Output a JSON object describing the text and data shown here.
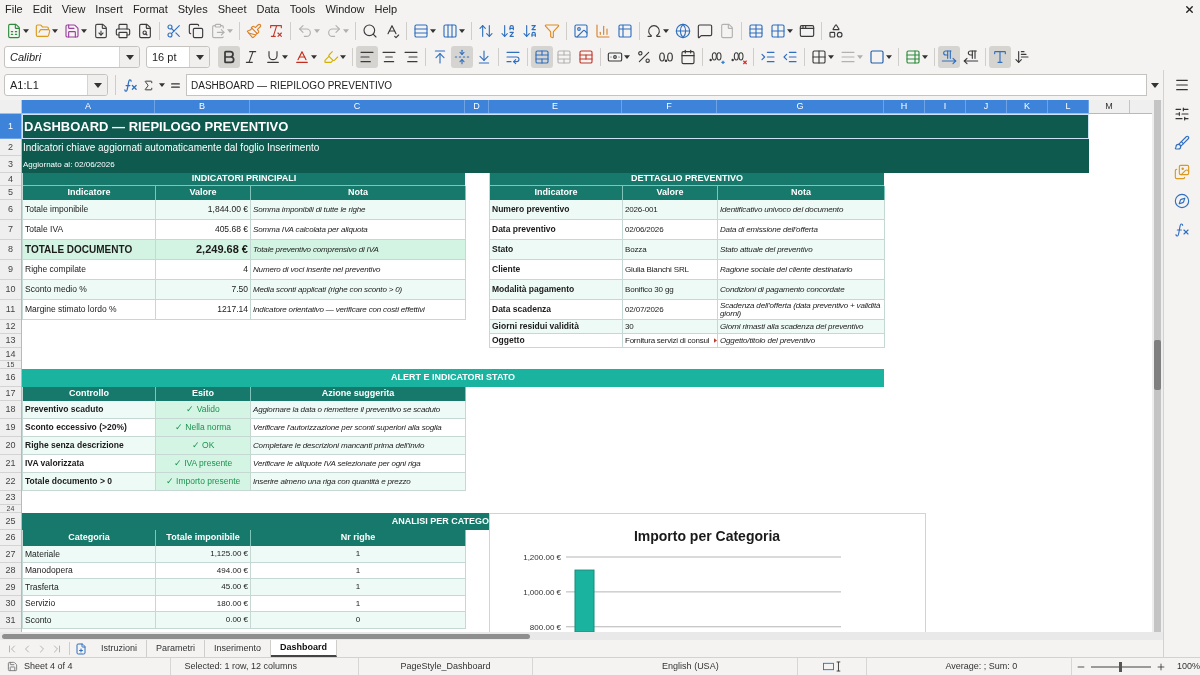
{
  "menu_bar": {
    "items": [
      "File",
      "Edit",
      "View",
      "Insert",
      "Format",
      "Styles",
      "Sheet",
      "Data",
      "Tools",
      "Window",
      "Help"
    ]
  },
  "standard_toolbar": {
    "buttons": [
      {
        "kind": "new",
        "disabled": false
      },
      {
        "kind": "open",
        "disabled": false
      },
      {
        "kind": "save",
        "disabled": false
      },
      {
        "kind": "export_pdf",
        "disabled": false
      },
      {
        "kind": "print",
        "disabled": false
      },
      {
        "kind": "print_preview",
        "disabled": false
      },
      {
        "kind": "cut",
        "disabled": false
      },
      {
        "kind": "copy",
        "disabled": false
      },
      {
        "kind": "paste",
        "disabled": true
      },
      {
        "kind": "clone_formatting",
        "disabled": false
      },
      {
        "kind": "clear_formatting",
        "disabled": false
      },
      {
        "kind": "undo",
        "disabled": true
      },
      {
        "kind": "redo",
        "disabled": true
      },
      {
        "kind": "find_replace",
        "disabled": false
      },
      {
        "kind": "spelling",
        "disabled": false
      },
      {
        "kind": "row",
        "disabled": false
      },
      {
        "kind": "column",
        "disabled": false
      },
      {
        "kind": "sort",
        "disabled": false
      },
      {
        "kind": "sort_ascending",
        "disabled": false
      },
      {
        "kind": "sort_descending",
        "disabled": false
      },
      {
        "kind": "autofilter",
        "disabled": false
      },
      {
        "kind": "image",
        "disabled": false
      },
      {
        "kind": "chart",
        "disabled": false
      },
      {
        "kind": "pivot_table",
        "disabled": false
      },
      {
        "kind": "special_character",
        "disabled": false
      },
      {
        "kind": "hyperlink",
        "disabled": false
      },
      {
        "kind": "comment",
        "disabled": false
      },
      {
        "kind": "header_footer",
        "disabled": true
      },
      {
        "kind": "print_area",
        "disabled": false
      },
      {
        "kind": "freeze",
        "disabled": false
      },
      {
        "kind": "split_window",
        "disabled": false
      },
      {
        "kind": "draw_functions",
        "disabled": false
      }
    ]
  },
  "formatting_toolbar": {
    "font_name": "Calibri",
    "font_size": "16 pt",
    "buttons": [
      {
        "kind": "bold",
        "active": true,
        "disabled": false
      },
      {
        "kind": "italic",
        "active": false,
        "disabled": false
      },
      {
        "kind": "underline",
        "active": false,
        "disabled": false
      },
      {
        "kind": "font_color",
        "active": false,
        "disabled": false
      },
      {
        "kind": "highlight",
        "active": false,
        "disabled": false
      },
      {
        "kind": "align_left",
        "active": true,
        "disabled": false
      },
      {
        "kind": "align_center",
        "active": false,
        "disabled": false
      },
      {
        "kind": "align_right",
        "active": false,
        "disabled": false
      },
      {
        "kind": "align_top",
        "active": false,
        "disabled": false
      },
      {
        "kind": "align_middle",
        "active": true,
        "disabled": false
      },
      {
        "kind": "align_bottom",
        "active": false,
        "disabled": false
      },
      {
        "kind": "wrap",
        "active": false,
        "disabled": false
      },
      {
        "kind": "merge_center",
        "active": true,
        "disabled": false
      },
      {
        "kind": "merge",
        "active": false,
        "disabled": true
      },
      {
        "kind": "unmerge",
        "active": false,
        "disabled": false
      },
      {
        "kind": "currency",
        "active": false,
        "disabled": false
      },
      {
        "kind": "percent",
        "active": false,
        "disabled": false
      },
      {
        "kind": "number",
        "active": false,
        "disabled": false
      },
      {
        "kind": "date",
        "active": false,
        "disabled": false
      },
      {
        "kind": "add_decimal",
        "active": false,
        "disabled": false
      },
      {
        "kind": "delete_decimal",
        "active": false,
        "disabled": false
      },
      {
        "kind": "indent_increase",
        "active": false,
        "disabled": false
      },
      {
        "kind": "indent_decrease",
        "active": false,
        "disabled": false
      },
      {
        "kind": "borders",
        "active": false,
        "disabled": false
      },
      {
        "kind": "border_style",
        "active": false,
        "disabled": true
      },
      {
        "kind": "border_color",
        "active": false,
        "disabled": false
      },
      {
        "kind": "conditional",
        "active": false,
        "disabled": false
      },
      {
        "kind": "ltr",
        "active": true,
        "disabled": false
      },
      {
        "kind": "rtl",
        "active": false,
        "disabled": false
      },
      {
        "kind": "horizontal_text",
        "active": true,
        "disabled": false
      },
      {
        "kind": "vertical_text",
        "active": false,
        "disabled": false
      }
    ]
  },
  "formula_bar": {
    "name_box": "A1:L1",
    "content": "DASHBOARD — RIEPILOGO PREVENTIVO"
  },
  "sheet": {
    "columns": [
      {
        "label": "A",
        "selected": true
      },
      {
        "label": "B",
        "selected": true
      },
      {
        "label": "C",
        "selected": true
      },
      {
        "label": "D",
        "selected": true
      },
      {
        "label": "E",
        "selected": true
      },
      {
        "label": "F",
        "selected": true
      },
      {
        "label": "G",
        "selected": true
      },
      {
        "label": "H",
        "selected": true
      },
      {
        "label": "I",
        "selected": true
      },
      {
        "label": "J",
        "selected": true
      },
      {
        "label": "K",
        "selected": true
      },
      {
        "label": "L",
        "selected": true
      },
      {
        "label": "M",
        "selected": false
      }
    ],
    "rows": [
      {
        "label": "1",
        "selected": true
      },
      {
        "label": "2",
        "selected": false
      },
      {
        "label": "3",
        "selected": false
      },
      {
        "label": "4",
        "selected": false
      },
      {
        "label": "5",
        "selected": false
      },
      {
        "label": "6",
        "selected": false
      },
      {
        "label": "7",
        "selected": false
      },
      {
        "label": "8",
        "selected": false
      },
      {
        "label": "9",
        "selected": false
      },
      {
        "label": "10",
        "selected": false
      },
      {
        "label": "11",
        "selected": false
      },
      {
        "label": "12",
        "selected": false
      },
      {
        "label": "13",
        "selected": false
      },
      {
        "label": "14",
        "selected": false
      },
      {
        "label": "15",
        "selected": false
      },
      {
        "label": "16",
        "selected": false
      },
      {
        "label": "17",
        "selected": false
      },
      {
        "label": "18",
        "selected": false
      },
      {
        "label": "19",
        "selected": false
      },
      {
        "label": "20",
        "selected": false
      },
      {
        "label": "21",
        "selected": false
      },
      {
        "label": "22",
        "selected": false
      },
      {
        "label": "23",
        "selected": false
      },
      {
        "label": "24",
        "selected": false
      },
      {
        "label": "25",
        "selected": false
      },
      {
        "label": "26",
        "selected": false
      },
      {
        "label": "27",
        "selected": false
      },
      {
        "label": "28",
        "selected": false
      },
      {
        "label": "29",
        "selected": false
      },
      {
        "label": "30",
        "selected": false
      },
      {
        "label": "31",
        "selected": false
      }
    ],
    "title": "DASHBOARD — RIEPILOGO PREVENTIVO",
    "subtitle": "Indicatori chiave aggiornati automaticamente dal foglio Inserimento",
    "updated": "Aggiornato al: 02/06/2026",
    "indicators": {
      "title": "INDICATORI PRINCIPALI",
      "columns": [
        "Indicatore",
        "Valore",
        "Nota"
      ],
      "rows": [
        {
          "label": "Totale imponibile",
          "value": "1,844.00 €",
          "note": "Somma imponibili di tutte le righe",
          "highlighted": false
        },
        {
          "label": "Totale IVA",
          "value": "405.68 €",
          "note": "Somma IVA calcolata per aliquota",
          "highlighted": false
        },
        {
          "label": "TOTALE DOCUMENTO",
          "value": "2,249.68 €",
          "note": "Totale preventivo comprensivo di IVA",
          "highlighted": true
        },
        {
          "label": "Righe compilate",
          "value": "4",
          "note": "Numero di voci inserite nel preventivo",
          "highlighted": false
        },
        {
          "label": "Sconto medio %",
          "value": "7.50",
          "note": "Media sconti applicati (righe con sconto > 0)",
          "highlighted": false
        },
        {
          "label": "Margine stimato lordo %",
          "value": "1217.14",
          "note": "Indicatore orientativo — verificare con costi effettivi",
          "highlighted": false
        }
      ]
    },
    "details": {
      "title": "DETTAGLIO PREVENTIVO",
      "columns": [
        "Indicatore",
        "Valore",
        "Nota"
      ],
      "rows": [
        {
          "label": "Numero preventivo",
          "value": "2026-001",
          "note": "Identificativo univoco del documento",
          "clipped": false
        },
        {
          "label": "Data preventivo",
          "value": "02/06/2026",
          "note": "Data di emissione dell'offerta",
          "clipped": false
        },
        {
          "label": "Stato",
          "value": "Bozza",
          "note": "Stato attuale del preventivo",
          "clipped": false
        },
        {
          "label": "Cliente",
          "value": "Giulia Bianchi SRL",
          "note": "Ragione sociale del cliente destinatario",
          "clipped": false
        },
        {
          "label": "Modalità pagamento",
          "value": "Bonifico 30 gg",
          "note": "Condizioni di pagamento concordate",
          "clipped": false
        },
        {
          "label": "Data scadenza",
          "value": "02/07/2026",
          "note": "Scadenza dell'offerta (data preventivo + validità giorni)",
          "clipped": false
        },
        {
          "label": "Giorni residui validità",
          "value": "30",
          "note": "Giorni rimasti alla scadenza del preventivo",
          "clipped": false
        },
        {
          "label": "Oggetto",
          "value": "Fornitura servizi di consul",
          "note": "Oggetto/titolo del preventivo",
          "clipped": true
        }
      ]
    },
    "alerts": {
      "title": "ALERT E INDICATORI STATO",
      "columns": [
        "Controllo",
        "Esito",
        "Azione suggerita"
      ],
      "rows": [
        {
          "check": "Preventivo scaduto",
          "result": "✓ Valido",
          "ok": true,
          "action": "Aggiornare la data o riemettere il preventivo se scaduto"
        },
        {
          "check": "Sconto eccessivo (>20%)",
          "result": "✓ Nella norma",
          "ok": true,
          "action": "Verificare l'autorizzazione per sconti superiori alla soglia"
        },
        {
          "check": "Righe senza descrizione",
          "result": "✓ OK",
          "ok": true,
          "action": "Completare le descrizioni mancanti prima dell'invio"
        },
        {
          "check": "IVA valorizzata",
          "result": "✓ IVA presente",
          "ok": true,
          "action": "Verificare le aliquote IVA selezionate per ogni riga"
        },
        {
          "check": "Totale documento > 0",
          "result": "✓ Importo presente",
          "ok": true,
          "action": "Inserire almeno una riga con quantità e prezzo"
        }
      ]
    },
    "categories": {
      "title": "ANALISI PER CATEGO",
      "columns": [
        "Categoria",
        "Totale imponibile",
        "Nr righe"
      ],
      "rows": [
        {
          "category": "Materiale",
          "total": "1,125.00 €",
          "count": "1"
        },
        {
          "category": "Manodopera",
          "total": "494.00 €",
          "count": "1"
        },
        {
          "category": "Trasferta",
          "total": "45.00 €",
          "count": "1"
        },
        {
          "category": "Servizio",
          "total": "180.00 €",
          "count": "1"
        },
        {
          "category": "Sconto",
          "total": "0.00 €",
          "count": "0"
        }
      ]
    },
    "chart": {
      "chart_data": {
        "type": "bar",
        "title": "Importo per Categoria",
        "values": [
          1125
        ],
        "ylim": [
          770,
          1200
        ],
        "grid": true,
        "yticks": [
          {
            "value": 800,
            "label": "800.00 €"
          },
          {
            "value": 1000,
            "label": "1,000.00 €"
          },
          {
            "value": 1200,
            "label": "1,200.00 €"
          }
        ]
      }
    }
  },
  "sheet_tabs": {
    "tabs": [
      {
        "label": "Istruzioni",
        "selected": false
      },
      {
        "label": "Parametri",
        "selected": false
      },
      {
        "label": "Inserimento",
        "selected": false
      },
      {
        "label": "Dashboard",
        "selected": true
      }
    ]
  },
  "sidebar": {
    "items": [
      {
        "kind": "menu"
      },
      {
        "kind": "properties"
      },
      {
        "kind": "styles"
      },
      {
        "kind": "gallery"
      },
      {
        "kind": "navigator"
      },
      {
        "kind": "functions"
      }
    ]
  },
  "status_bar": {
    "sheet": "Sheet 4 of 4",
    "selection": "Selected: 1 row, 12 columns",
    "page_style": "PageStyle_Dashboard",
    "language": "English (USA)",
    "summary": "Average: ; Sum: 0",
    "zoom": {
      "level": 0.5,
      "reading": "100%"
    }
  }
}
